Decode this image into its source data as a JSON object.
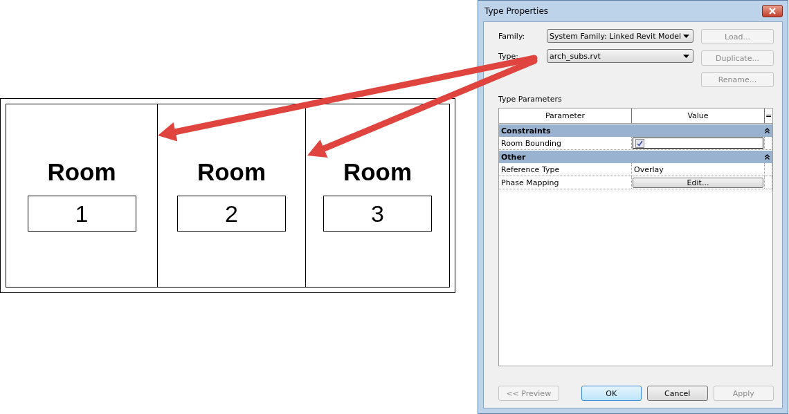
{
  "drawing": {
    "rooms": [
      {
        "label": "Room",
        "number": "1"
      },
      {
        "label": "Room",
        "number": "2"
      },
      {
        "label": "Room",
        "number": "3"
      }
    ]
  },
  "dialog": {
    "title": "Type Properties",
    "fields": [
      {
        "label": "Family:",
        "value": "System Family: Linked Revit Model"
      },
      {
        "label": "Type:",
        "value": "arch_subs.rvt"
      }
    ],
    "side_buttons": [
      {
        "label": "Load...",
        "disabled": true
      },
      {
        "label": "Duplicate...",
        "disabled": true
      },
      {
        "label": "Rename...",
        "disabled": true
      }
    ],
    "section_label": "Type Parameters",
    "table": {
      "columns": [
        "Parameter",
        "Value",
        "="
      ],
      "groups": [
        {
          "name": "Constraints",
          "expanded": true,
          "rows": [
            {
              "kind": "checkbox",
              "name": "Room Bounding",
              "checked": true
            }
          ]
        },
        {
          "name": "Other",
          "expanded": true,
          "rows": [
            {
              "kind": "text",
              "name": "Reference Type",
              "value": "Overlay"
            },
            {
              "kind": "button",
              "name": "Phase Mapping",
              "value": "Edit..."
            }
          ]
        }
      ]
    },
    "buttons": [
      {
        "label": "<< Preview",
        "disabled": true,
        "default": false
      },
      {
        "label": "OK",
        "disabled": false,
        "default": true
      },
      {
        "label": "Cancel",
        "disabled": false,
        "default": false
      },
      {
        "label": "Apply",
        "disabled": true,
        "default": false
      }
    ]
  }
}
